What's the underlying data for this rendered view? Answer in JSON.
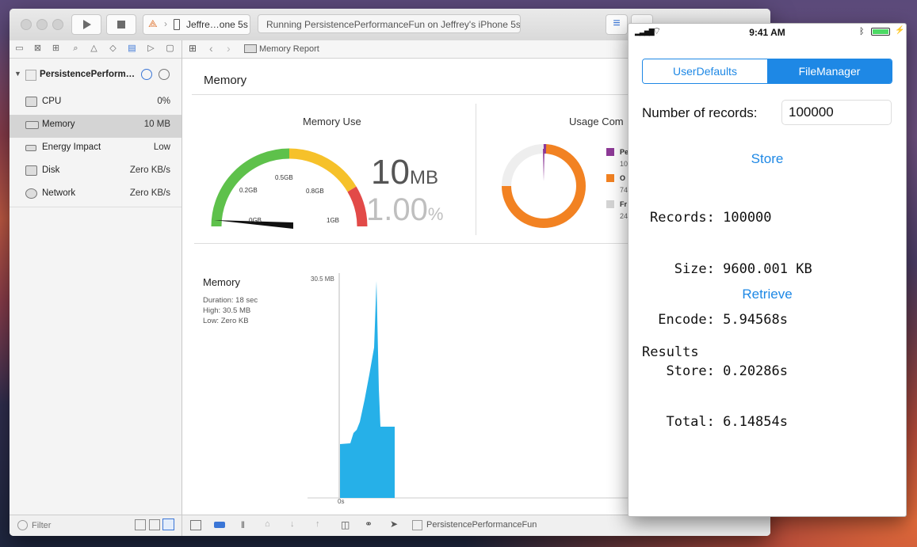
{
  "xcode": {
    "scheme": "Jeffre…one 5s",
    "status": "Running PersistencePerformanceFun on Jeffrey's iPhone 5s",
    "project": "PersistencePerform…",
    "gauges": [
      {
        "label": "CPU",
        "value": "0%"
      },
      {
        "label": "Memory",
        "value": "10 MB"
      },
      {
        "label": "Energy Impact",
        "value": "Low"
      },
      {
        "label": "Disk",
        "value": "Zero KB/s"
      },
      {
        "label": "Network",
        "value": "Zero KB/s"
      }
    ],
    "filter_placeholder": "Filter",
    "breadcrumb": "Memory Report",
    "report_title": "Memory",
    "memory_use": {
      "title": "Memory Use",
      "value": "10",
      "unit": "MB",
      "percent": "1.00",
      "percent_sign": "%",
      "ticks": [
        "0GB",
        "0.2GB",
        "0.5GB",
        "0.8GB",
        "1GB"
      ]
    },
    "usage": {
      "title": "Usage Com",
      "legend": [
        {
          "code": "Pe",
          "value": "10",
          "color": "#8e3a97"
        },
        {
          "code": "O",
          "value": "74",
          "color": "#f28222"
        },
        {
          "code": "Fr",
          "value": "24",
          "color": "#d5d5d5"
        }
      ]
    },
    "timeline": {
      "title": "Memory",
      "duration": "Duration: 18 sec",
      "high": "High: 30.5 MB",
      "low": "Low: Zero KB",
      "ymax_label": "30.5 MB",
      "x_label": "0s"
    },
    "bottom_target": "PersistencePerformanceFun"
  },
  "phone": {
    "time": "9:41 AM",
    "segments": [
      "UserDefaults",
      "FileManager"
    ],
    "selected_segment": "FileManager",
    "records_label": "Number of records:",
    "records_value": "100000",
    "store_button": "Store",
    "retrieve_button": "Retrieve",
    "results_lines": [
      "Records: 100000",
      "   Size: 9600.001 KB",
      " Encode: 5.94568s",
      "  Store: 0.20286s",
      "  Total: 6.14854s"
    ],
    "results_label": "Results",
    "accent": "#1e88e5"
  }
}
